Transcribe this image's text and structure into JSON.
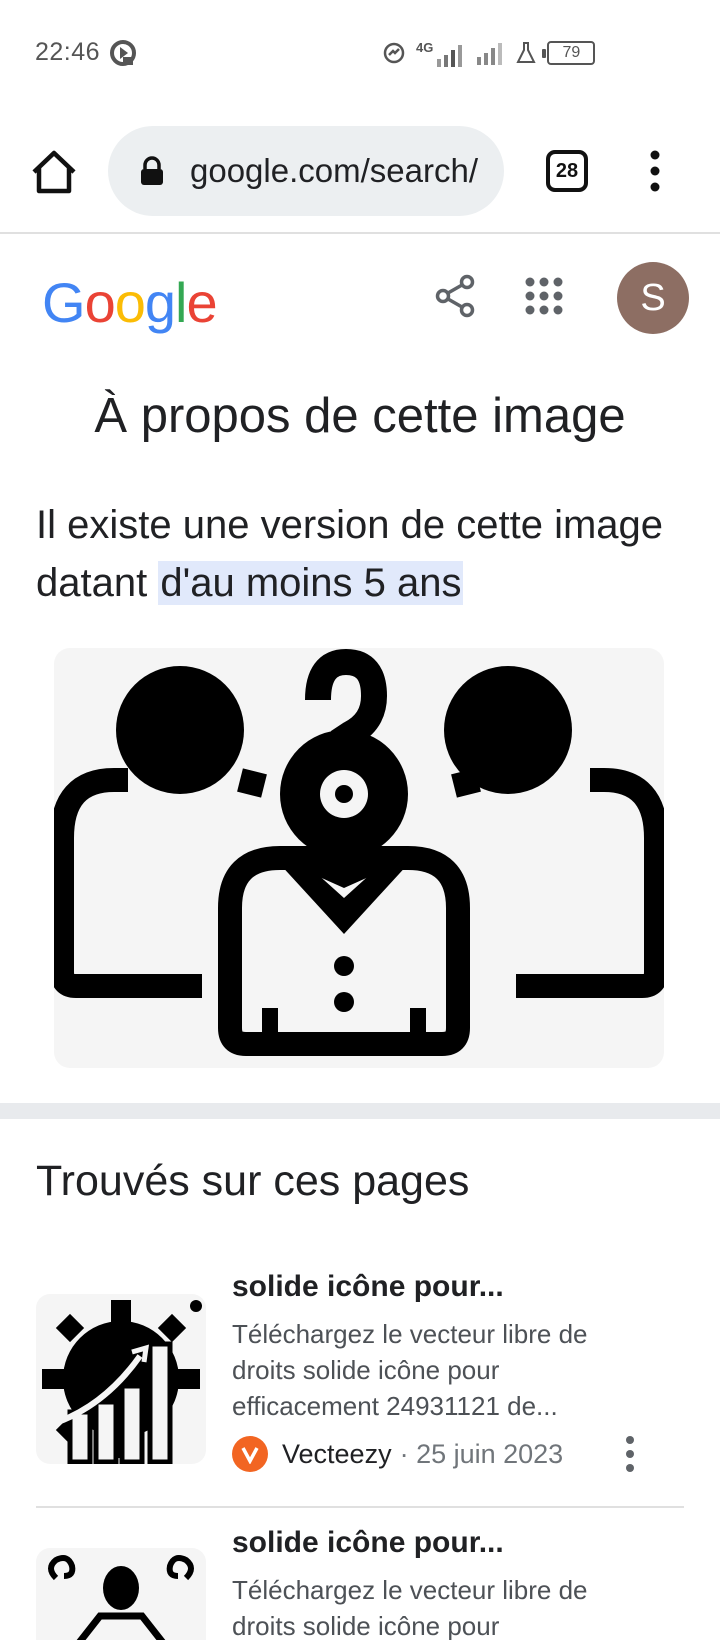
{
  "status_bar": {
    "time": "22:46",
    "network": "4G",
    "battery": "79"
  },
  "browser": {
    "url": "google.com/search/",
    "tab_count": "28"
  },
  "google": {
    "logo_letters": [
      "G",
      "o",
      "o",
      "g",
      "l",
      "e"
    ],
    "logo_colors": [
      "#4285F4",
      "#EA4335",
      "#FBBC05",
      "#4285F4",
      "#34A853",
      "#EA4335"
    ],
    "avatar_letter": "S",
    "avatar_color": "#8d6e63"
  },
  "page": {
    "title": "À propos de cette image",
    "headline_prefix": "Il existe une version de cette image datant ",
    "headline_highlight": "d'au moins 5 ans",
    "section_title": "Trouvés sur ces pages"
  },
  "results": [
    {
      "title": "solide icône pour...",
      "description": "Téléchargez le vecteur libre de droits solide icône pour efficacement 24931121 de...",
      "source": "Vecteezy",
      "date": "· 25 juin 2023",
      "thumbnail_icon": "gear-chart-icon"
    },
    {
      "title": "solide icône pour...",
      "description": "Téléchargez le vecteur libre de droits solide icône pour",
      "thumbnail_icon": "person-swirl-icon"
    }
  ],
  "colors": {
    "highlight": "#e1e9fb",
    "vecteezy_orange": "#f26522"
  }
}
